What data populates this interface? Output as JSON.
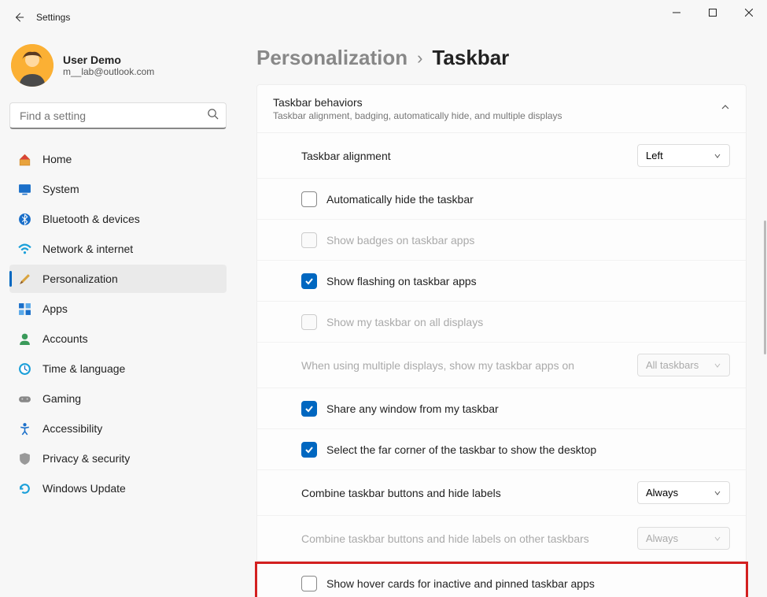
{
  "window": {
    "title": "Settings"
  },
  "profile": {
    "name": "User Demo",
    "email": "m__lab@outlook.com"
  },
  "search": {
    "placeholder": "Find a setting"
  },
  "nav": {
    "items": [
      {
        "label": "Home"
      },
      {
        "label": "System"
      },
      {
        "label": "Bluetooth & devices"
      },
      {
        "label": "Network & internet"
      },
      {
        "label": "Personalization"
      },
      {
        "label": "Apps"
      },
      {
        "label": "Accounts"
      },
      {
        "label": "Time & language"
      },
      {
        "label": "Gaming"
      },
      {
        "label": "Accessibility"
      },
      {
        "label": "Privacy & security"
      },
      {
        "label": "Windows Update"
      }
    ]
  },
  "breadcrumb": {
    "parent": "Personalization",
    "current": "Taskbar"
  },
  "panel": {
    "title": "Taskbar behaviors",
    "subtitle": "Taskbar alignment, badging, automatically hide, and multiple displays"
  },
  "rows": {
    "alignment": {
      "label": "Taskbar alignment",
      "value": "Left"
    },
    "autohide": {
      "label": "Automatically hide the taskbar"
    },
    "badges": {
      "label": "Show badges on taskbar apps"
    },
    "flashing": {
      "label": "Show flashing on taskbar apps"
    },
    "allDisplays": {
      "label": "Show my taskbar on all displays"
    },
    "multiDisplays": {
      "label": "When using multiple displays, show my taskbar apps on",
      "value": "All taskbars"
    },
    "shareWindow": {
      "label": "Share any window from my taskbar"
    },
    "farCorner": {
      "label": "Select the far corner of the taskbar to show the desktop"
    },
    "combine": {
      "label": "Combine taskbar buttons and hide labels",
      "value": "Always"
    },
    "combineOther": {
      "label": "Combine taskbar buttons and hide labels on other taskbars",
      "value": "Always"
    },
    "hoverCards": {
      "label": "Show hover cards for inactive and pinned taskbar apps"
    }
  }
}
